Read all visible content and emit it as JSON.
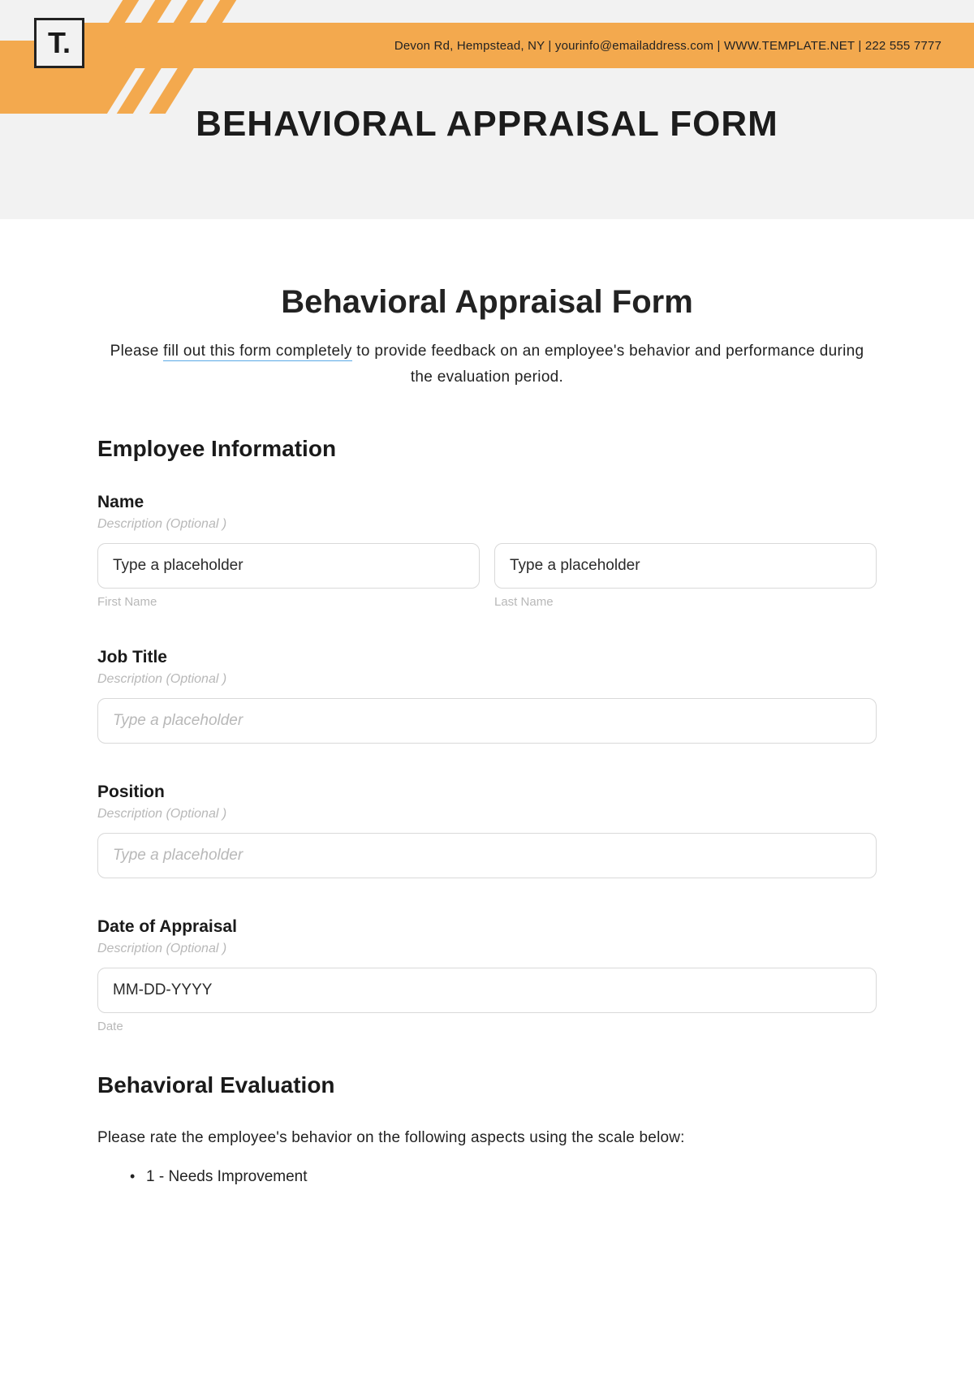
{
  "header": {
    "logo_text": "T.",
    "contact_line": "Devon Rd, Hempstead, NY | yourinfo@emailaddress.com | WWW.TEMPLATE.NET | 222 555 7777",
    "banner_title": "BEHAVIORAL APPRAISAL FORM"
  },
  "form": {
    "title": "Behavioral Appraisal Form",
    "intro_prefix": "Please ",
    "intro_underlined": "fill out this form completely",
    "intro_suffix": " to provide feedback on an employee's behavior and performance during the evaluation period.",
    "section_employee": "Employee Information",
    "fields": {
      "name": {
        "label": "Name",
        "desc": "Description  (Optional )",
        "first_value": "Type a placeholder",
        "last_value": "Type a placeholder",
        "first_sub": "First Name",
        "last_sub": "Last Name"
      },
      "job_title": {
        "label": "Job Title",
        "desc": "Description  (Optional )",
        "placeholder": "Type a placeholder"
      },
      "position": {
        "label": "Position",
        "desc": "Description (Optional )",
        "placeholder": "Type a placeholder"
      },
      "date": {
        "label": "Date of Appraisal",
        "desc": "Description  (Optional )",
        "value": "MM-DD-YYYY",
        "sub": "Date"
      }
    },
    "section_eval": "Behavioral Evaluation",
    "eval_intro": "Please rate the employee's behavior on the following aspects using the scale below:",
    "scale": [
      "1 - Needs Improvement"
    ]
  }
}
